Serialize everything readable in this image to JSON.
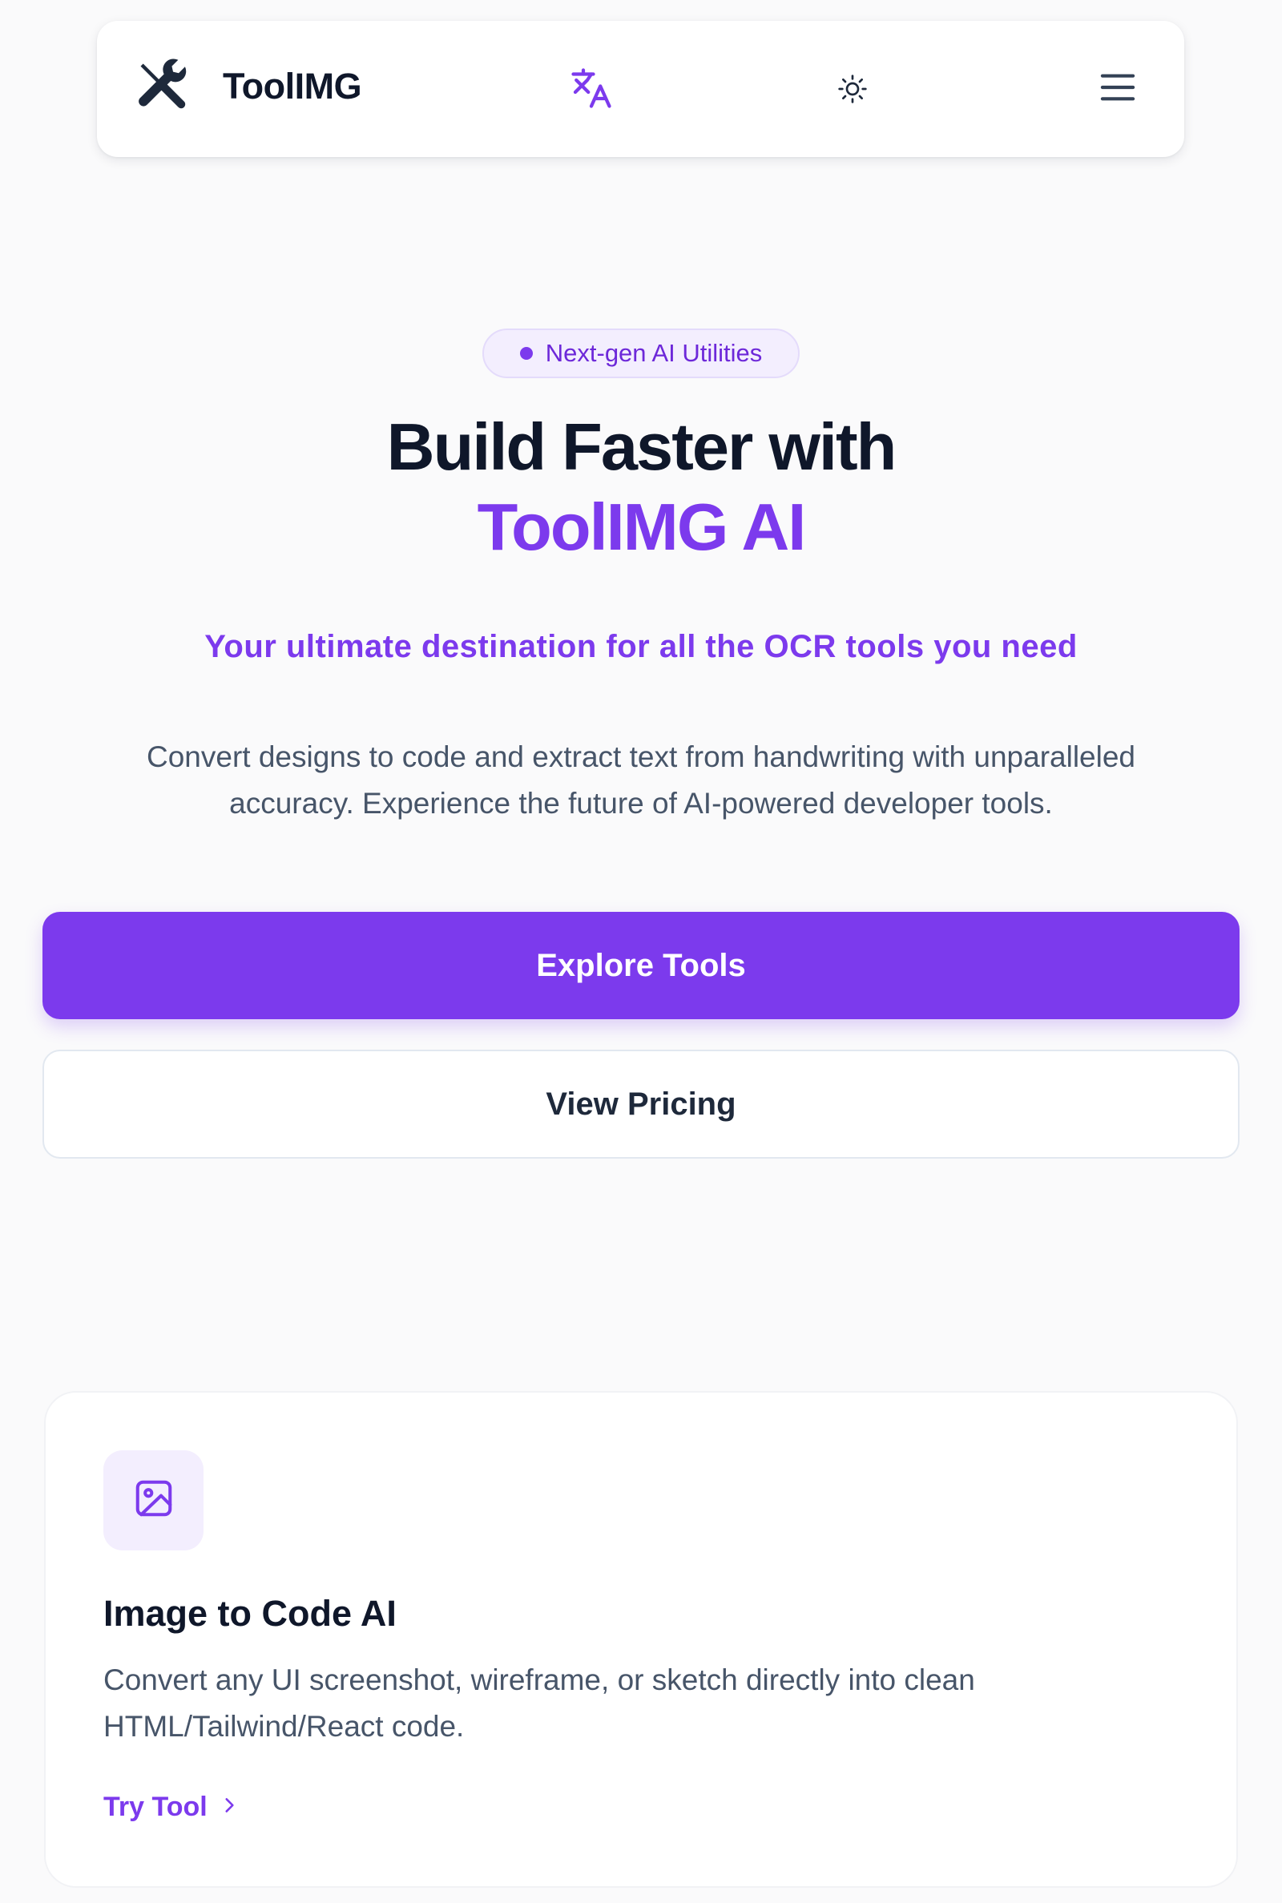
{
  "header": {
    "brand": "ToolIMG",
    "icons": {
      "logo": "wrench-screwdriver-icon",
      "translate": "translate-icon",
      "theme": "sun-icon",
      "menu": "hamburger-menu-icon"
    }
  },
  "hero": {
    "badge": "Next-gen AI Utilities",
    "title_line1": "Build Faster with",
    "title_line2": "ToolIMG AI",
    "tagline": "Your ultimate destination for all the OCR tools you need",
    "description": "Convert designs to code and extract text from handwriting with unparalleled accuracy. Experience the future of AI-powered developer tools.",
    "primary_cta": "Explore Tools",
    "secondary_cta": "View Pricing"
  },
  "tools": [
    {
      "icon": "image-icon",
      "title": "Image to Code AI",
      "description": "Convert any UI screenshot, wireframe, or sketch directly into clean HTML/Tailwind/React code.",
      "link": "Try Tool"
    }
  ],
  "colors": {
    "accent": "#7c3aed",
    "accent_soft": "#f3eefe",
    "text_dark": "#0f172a",
    "text_muted": "#475569",
    "background": "#fafafb"
  }
}
